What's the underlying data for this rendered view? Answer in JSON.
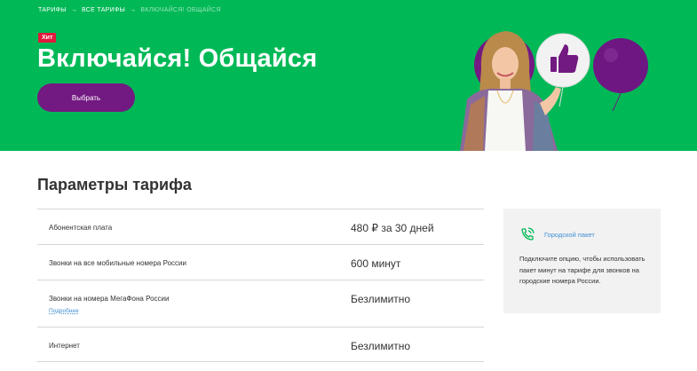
{
  "breadcrumb": {
    "items": [
      "ТАРИФЫ",
      "ВСЕ ТАРИФЫ",
      "ВКЛЮЧАЙСЯ! ОБЩАЙСЯ"
    ],
    "separator": "→"
  },
  "hero": {
    "badge": "Хит",
    "title": "Включайся! Общайся",
    "button_label": "Выбрать",
    "bg_color": "#00b956"
  },
  "params": {
    "title": "Параметры тарифа",
    "rows": [
      {
        "label": "Абонентская плата",
        "value": "480 ₽ за 30 дней",
        "link": ""
      },
      {
        "label": "Звонки на все мобильные номера России",
        "value": "600 минут",
        "link": ""
      },
      {
        "label": "Звонки на номера МегаФона России",
        "value": "Безлимитно",
        "link": "Подробнее"
      },
      {
        "label": "Интернет",
        "value": "Безлимитно",
        "link": ""
      }
    ]
  },
  "side_card": {
    "icon": "phone-call-icon",
    "link": "Городской пакет",
    "text": "Подключите опцию, чтобы использовать пакет минут на тарифе для звонков на городские номера России."
  },
  "colors": {
    "accent_purple": "#731982",
    "brand_green": "#00b956",
    "badge_red": "#e1193c",
    "link_blue": "#3f8fd2"
  }
}
